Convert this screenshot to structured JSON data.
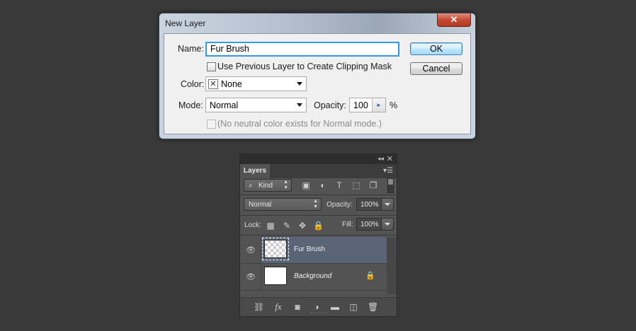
{
  "dialog": {
    "title": "New Layer",
    "close_glyph": "✕",
    "name_label": "Name:",
    "name_value": "Fur Brush",
    "clipping_label": "Use Previous Layer to Create Clipping Mask",
    "color_label": "Color:",
    "color_value": "None",
    "mode_label": "Mode:",
    "mode_value": "Normal",
    "opacity_label": "Opacity:",
    "opacity_value": "100",
    "opacity_unit": "%",
    "neutral_label": "(No neutral color exists for Normal mode.)",
    "ok_label": "OK",
    "cancel_label": "Cancel"
  },
  "layers_panel": {
    "tab_label": "Layers",
    "kind_label": "Kind",
    "blend_mode": "Normal",
    "opacity_label": "Opacity:",
    "opacity_value": "100%",
    "lock_label": "Lock:",
    "fill_label": "Fill:",
    "fill_value": "100%",
    "layers": [
      {
        "name": "Fur Brush",
        "selected": true
      },
      {
        "name": "Background",
        "locked": true
      }
    ],
    "icons": {
      "filter": [
        "image-filter-icon",
        "adjustment-filter-icon",
        "type-filter-icon",
        "shape-filter-icon",
        "smart-object-filter-icon"
      ],
      "lock": [
        "lock-transparent-icon",
        "lock-image-icon",
        "lock-position-icon",
        "lock-all-icon"
      ],
      "footer": [
        "link-layers-icon",
        "fx-icon",
        "add-mask-icon",
        "new-adjustment-icon",
        "new-group-icon",
        "new-layer-icon",
        "delete-layer-icon"
      ]
    }
  }
}
